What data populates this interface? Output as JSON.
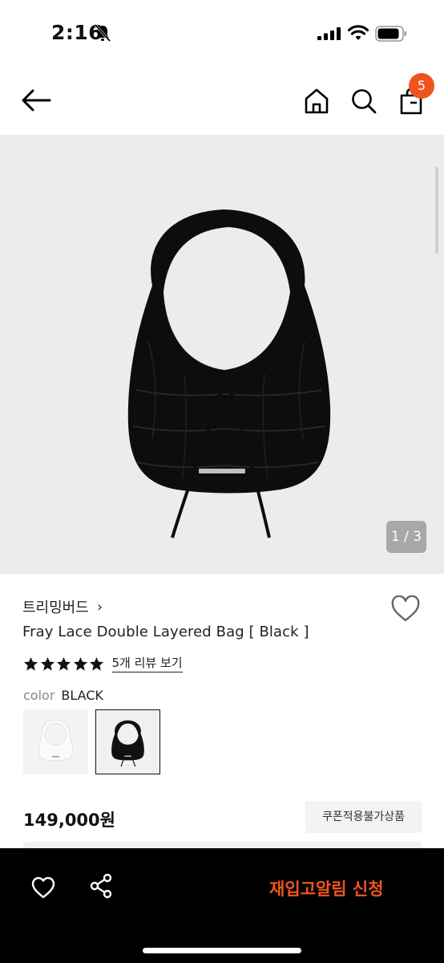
{
  "status_bar": {
    "time": "2:16",
    "icons": [
      "bell-off-icon",
      "signal-icon",
      "wifi-icon",
      "battery-icon"
    ]
  },
  "nav": {
    "icons": [
      "back-arrow-icon",
      "home-icon",
      "search-icon",
      "shopping-bag-icon"
    ],
    "cart_count": "5"
  },
  "gallery": {
    "page_indicator": "1 / 3"
  },
  "product": {
    "brand": "트리밍버드",
    "brand_chevron": "›",
    "title": "Fray Lace Double Layered Bag [ Black ]",
    "rating": 5,
    "rating_max": 5,
    "review_link": "5개 리뷰 보기",
    "color_label": "color",
    "color_value": "BLACK",
    "swatches": [
      {
        "name": "white",
        "selected": false
      },
      {
        "name": "black",
        "selected": true
      }
    ],
    "price": "149,000원",
    "coupon_tag": "쿠폰적용불가상품"
  },
  "bottom_bar": {
    "icons": [
      "heart-icon",
      "share-icon"
    ],
    "restock_label": "재입고알림 신청"
  },
  "colors": {
    "accent": "#f0541e",
    "gallery_bg": "#ececec",
    "bottom_bar_bg": "#000000"
  }
}
